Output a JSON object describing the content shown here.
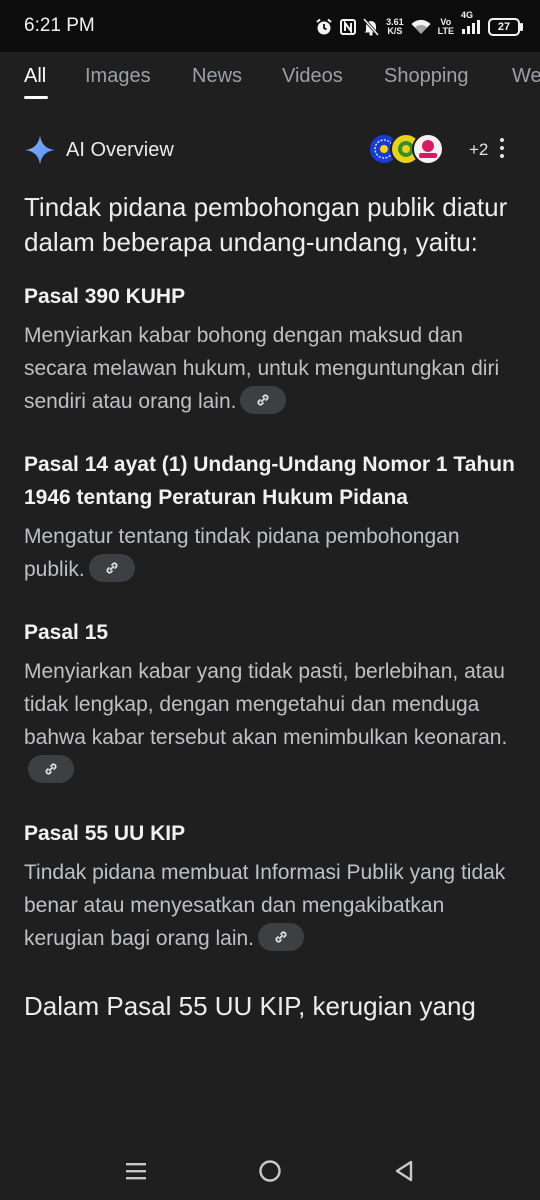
{
  "status_bar": {
    "time": "6:21 PM",
    "net_speed_value": "3.61",
    "net_speed_unit": "K/S",
    "volte_top": "Vo",
    "volte_bottom": "LTE",
    "network_type": "4G",
    "battery": "27"
  },
  "tabs": [
    "All",
    "Images",
    "News",
    "Videos",
    "Shopping",
    "We"
  ],
  "ai_overview": {
    "title": "AI Overview",
    "sources_more": "+2"
  },
  "content": {
    "intro": "Tindak pidana pembohongan publik diatur dalam beberapa undang-undang, yaitu:",
    "sections": [
      {
        "title": "Pasal 390 KUHP",
        "body": "Menyiarkan kabar bohong dengan maksud dan secara melawan hukum, untuk menguntungkan diri sendiri atau orang lain."
      },
      {
        "title": "Pasal 14 ayat (1) Undang-Undang Nomor 1 Tahun 1946 tentang Peraturan Hukum Pidana",
        "body": "Mengatur tentang tindak pidana pembohongan publik."
      },
      {
        "title": "Pasal 15",
        "body": "Menyiarkan kabar yang tidak pasti, berlebihan, atau tidak lengkap, dengan mengetahui dan menduga bahwa kabar tersebut akan menimbulkan keonaran."
      },
      {
        "title": "Pasal 55 UU KIP",
        "body": "Tindak pidana membuat Informasi Publik yang tidak benar atau menyesatkan dan mengakibatkan kerugian bagi orang lain."
      }
    ],
    "closing": "Dalam Pasal 55 UU KIP, kerugian yang"
  },
  "icons": {
    "alarm": "alarm-icon",
    "nfc": "nfc-icon",
    "mute": "bell-off-icon",
    "wifi": "wifi-icon",
    "signal": "signal-icon",
    "sparkle": "sparkle-icon",
    "link": "link-icon",
    "more": "more-vert-icon",
    "nav_menu": "recents-icon",
    "nav_home": "home-icon",
    "nav_back": "back-icon"
  },
  "colors": {
    "background": "#1f1f1f",
    "status_bar": "#0d0d0d",
    "text_primary": "#e3e3e3",
    "text_secondary": "#bdc1c6",
    "chip": "#3c4043",
    "sparkle_blue": "#8ab4f8"
  }
}
